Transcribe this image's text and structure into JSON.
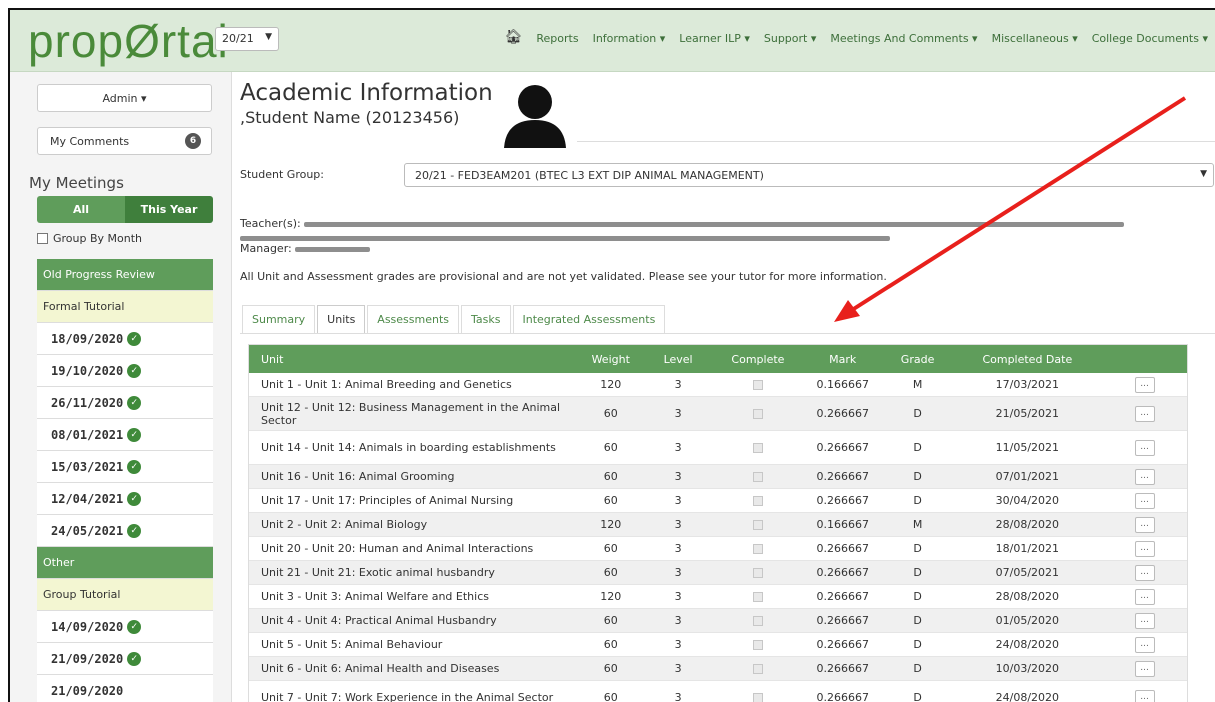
{
  "header": {
    "logo": "propØrtal",
    "year": "20/21",
    "menu": [
      {
        "label": "Reports"
      },
      {
        "label": "Information ▾"
      },
      {
        "label": "Learner ILP ▾"
      },
      {
        "label": "Support ▾"
      },
      {
        "label": "Meetings And Comments ▾"
      },
      {
        "label": "Miscellaneous ▾"
      },
      {
        "label": "College Documents ▾"
      }
    ]
  },
  "sidebar": {
    "admin": "Admin ▾",
    "comments_label": "My Comments",
    "comments_count": "6",
    "meetings_title": "My Meetings",
    "seg_all": "All",
    "seg_year": "This Year",
    "group_by_month": "Group By Month",
    "items": [
      {
        "label": "Old Progress Review",
        "kind": "green"
      },
      {
        "label": "Formal Tutorial",
        "kind": "yellow"
      },
      {
        "label": "18/09/2020",
        "kind": "date",
        "done": true
      },
      {
        "label": "19/10/2020",
        "kind": "date",
        "done": true
      },
      {
        "label": "26/11/2020",
        "kind": "date",
        "done": true
      },
      {
        "label": "08/01/2021",
        "kind": "date",
        "done": true
      },
      {
        "label": "15/03/2021",
        "kind": "date",
        "done": true
      },
      {
        "label": "12/04/2021",
        "kind": "date",
        "done": true
      },
      {
        "label": "24/05/2021",
        "kind": "date",
        "done": true
      },
      {
        "label": "Other",
        "kind": "green"
      },
      {
        "label": "Group Tutorial",
        "kind": "yellow"
      },
      {
        "label": "14/09/2020",
        "kind": "date",
        "done": true
      },
      {
        "label": "21/09/2020",
        "kind": "date",
        "done": true
      },
      {
        "label": "21/09/2020",
        "kind": "date",
        "done": false
      }
    ]
  },
  "main": {
    "title": "Academic Information",
    "student": ",Student Name (20123456)",
    "student_group_label": "Student Group:",
    "student_group_value": "20/21 - FED3EAM201 (BTEC L3 EXT DIP ANIMAL MANAGEMENT)",
    "teachers_label": "Teacher(s):",
    "manager_label": "Manager:",
    "notice": "All Unit and Assessment grades are provisional and are not yet validated. Please see your tutor for more information.",
    "tabs": [
      "Summary",
      "Units",
      "Assessments",
      "Tasks",
      "Integrated Assessments"
    ],
    "active_tab": "Units"
  },
  "table": {
    "columns": [
      "Unit",
      "Weight",
      "Level",
      "Complete",
      "Mark",
      "Grade",
      "Completed Date",
      ""
    ],
    "rows": [
      {
        "unit": "Unit 1 - Unit 1: Animal Breeding and Genetics",
        "weight": "120",
        "level": "3",
        "mark": "0.166667",
        "grade": "M",
        "date": "17/03/2021"
      },
      {
        "unit": "Unit 12 - Unit 12: Business Management in the Animal Sector",
        "weight": "60",
        "level": "3",
        "mark": "0.266667",
        "grade": "D",
        "date": "21/05/2021"
      },
      {
        "unit": "Unit 14 - Unit 14: Animals in boarding establishments",
        "weight": "60",
        "level": "3",
        "mark": "0.266667",
        "grade": "D",
        "date": "11/05/2021"
      },
      {
        "unit": "Unit 16 - Unit 16: Animal Grooming",
        "weight": "60",
        "level": "3",
        "mark": "0.266667",
        "grade": "D",
        "date": "07/01/2021"
      },
      {
        "unit": "Unit 17 - Unit 17: Principles of Animal Nursing",
        "weight": "60",
        "level": "3",
        "mark": "0.266667",
        "grade": "D",
        "date": "30/04/2020"
      },
      {
        "unit": "Unit 2 - Unit 2: Animal Biology",
        "weight": "120",
        "level": "3",
        "mark": "0.166667",
        "grade": "M",
        "date": "28/08/2020"
      },
      {
        "unit": "Unit 20 - Unit 20: Human and Animal Interactions",
        "weight": "60",
        "level": "3",
        "mark": "0.266667",
        "grade": "D",
        "date": "18/01/2021"
      },
      {
        "unit": "Unit 21 - Unit 21: Exotic animal husbandry",
        "weight": "60",
        "level": "3",
        "mark": "0.266667",
        "grade": "D",
        "date": "07/05/2021"
      },
      {
        "unit": "Unit 3 - Unit 3: Animal Welfare and Ethics",
        "weight": "120",
        "level": "3",
        "mark": "0.266667",
        "grade": "D",
        "date": "28/08/2020"
      },
      {
        "unit": "Unit 4 - Unit 4: Practical Animal Husbandry",
        "weight": "60",
        "level": "3",
        "mark": "0.266667",
        "grade": "D",
        "date": "01/05/2020"
      },
      {
        "unit": "Unit 5 - Unit 5: Animal Behaviour",
        "weight": "60",
        "level": "3",
        "mark": "0.266667",
        "grade": "D",
        "date": "24/08/2020"
      },
      {
        "unit": "Unit 6 - Unit 6: Animal Health and Diseases",
        "weight": "60",
        "level": "3",
        "mark": "0.266667",
        "grade": "D",
        "date": "10/03/2020"
      },
      {
        "unit": "Unit 7 - Unit 7: Work Experience in the Animal Sector",
        "weight": "60",
        "level": "3",
        "mark": "0.266667",
        "grade": "D",
        "date": "24/08/2020"
      }
    ],
    "more_label": "..."
  },
  "colors": {
    "brand": "#4a8a3a",
    "header_green": "#5f9d5b",
    "arrow": "#e8201c"
  }
}
